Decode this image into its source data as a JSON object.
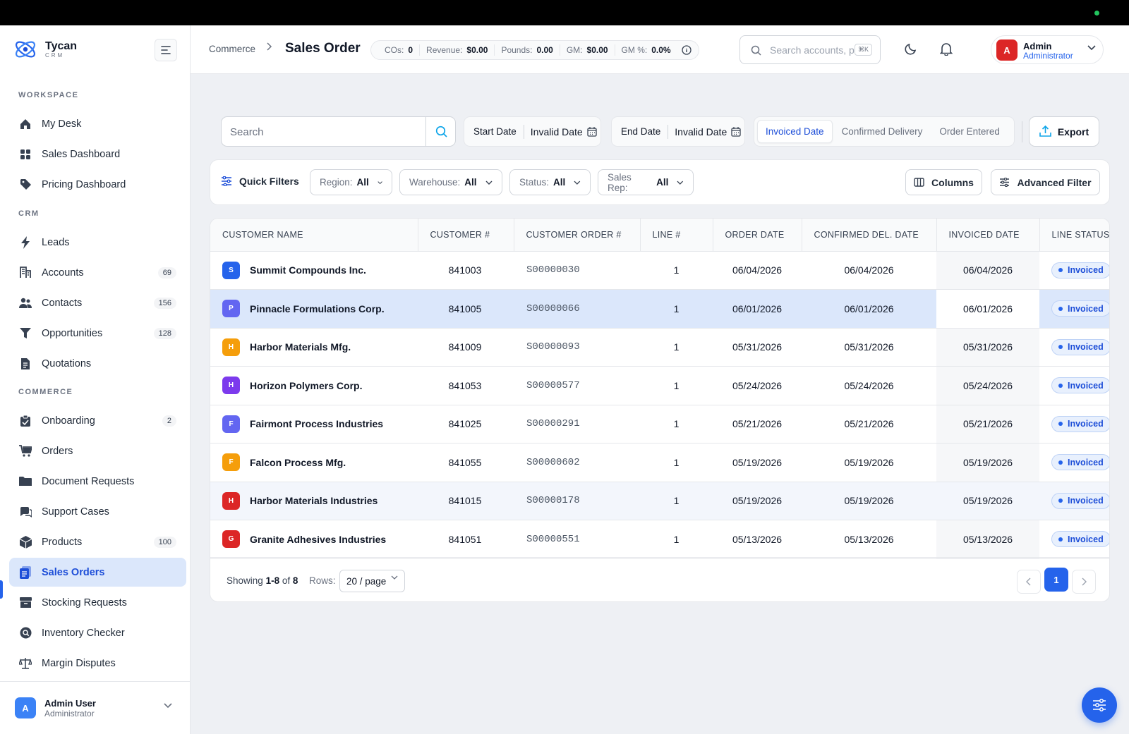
{
  "app": {
    "name": "Tycan",
    "sub": "CRM"
  },
  "sidebar": {
    "sections": [
      "WORKSPACE",
      "CRM",
      "COMMERCE"
    ],
    "workspace": [
      {
        "label": "My Desk",
        "icon": "home-icon"
      },
      {
        "label": "Sales Dashboard",
        "icon": "grid-icon"
      },
      {
        "label": "Pricing Dashboard",
        "icon": "tag-icon"
      }
    ],
    "crm": [
      {
        "label": "Leads",
        "icon": "bolt-icon",
        "count": ""
      },
      {
        "label": "Accounts",
        "icon": "building-icon",
        "count": "69"
      },
      {
        "label": "Contacts",
        "icon": "users-icon",
        "count": "156"
      },
      {
        "label": "Opportunities",
        "icon": "funnel-icon",
        "count": "128"
      },
      {
        "label": "Quotations",
        "icon": "document-icon",
        "count": ""
      }
    ],
    "commerce": [
      {
        "label": "Onboarding",
        "icon": "clipboard-icon",
        "count": "2"
      },
      {
        "label": "Orders",
        "icon": "cart-icon",
        "count": ""
      },
      {
        "label": "Document Requests",
        "icon": "folder-icon",
        "count": ""
      },
      {
        "label": "Support Cases",
        "icon": "chat-icon",
        "count": ""
      },
      {
        "label": "Products",
        "icon": "box-icon",
        "count": "100"
      },
      {
        "label": "Sales Orders",
        "icon": "receipt-icon",
        "count": ""
      },
      {
        "label": "Stocking Requests",
        "icon": "archive-icon",
        "count": ""
      },
      {
        "label": "Inventory Checker",
        "icon": "search-circle-icon",
        "count": ""
      },
      {
        "label": "Margin Disputes",
        "icon": "scale-icon",
        "count": ""
      }
    ],
    "user": {
      "initial": "A",
      "name": "Admin User",
      "role": "Administrator"
    }
  },
  "header": {
    "crumb_parent": "Commerce",
    "crumb_current": "Sales Order",
    "stats": [
      {
        "label": "COs:",
        "value": "0"
      },
      {
        "label": "Revenue:",
        "value": "$0.00"
      },
      {
        "label": "Pounds:",
        "value": "0.00"
      },
      {
        "label": "GM:",
        "value": "$0.00"
      },
      {
        "label": "GM %:",
        "value": "0.0%"
      }
    ],
    "search_placeholder": "Search accounts, p",
    "search_shortcut": "⌘K",
    "profile": {
      "initial": "A",
      "name": "Admin",
      "role": "Administrator"
    }
  },
  "toolbar": {
    "search_placeholder": "Search",
    "start_date_label": "Start Date",
    "start_date_value": "Invalid Date",
    "end_date_label": "End Date",
    "end_date_value": "Invalid Date",
    "date_modes": [
      "Invoiced Date",
      "Confirmed Delivery",
      "Order Entered"
    ],
    "active_mode": "Invoiced Date",
    "export_label": "Export"
  },
  "filters": {
    "quick_label": "Quick Filters",
    "dropdowns": [
      {
        "label": "Region:",
        "value": "All"
      },
      {
        "label": "Warehouse:",
        "value": "All"
      },
      {
        "label": "Status:",
        "value": "All"
      },
      {
        "label": "Sales Rep:",
        "value": "All"
      }
    ],
    "columns_label": "Columns",
    "advanced_label": "Advanced Filter"
  },
  "table": {
    "headers": [
      "CUSTOMER NAME",
      "CUSTOMER #",
      "CUSTOMER ORDER #",
      "LINE #",
      "ORDER DATE",
      "CONFIRMED DEL. DATE",
      "INVOICED DATE",
      "LINE STATUS"
    ],
    "rows": [
      {
        "initial": "S",
        "color": "#2563eb",
        "name": "Summit Compounds Inc.",
        "cust": "841003",
        "order": "S00000030",
        "line": "1",
        "order_date": "06/04/2026",
        "conf_date": "06/04/2026",
        "inv_date": "06/04/2026",
        "status": "Invoiced"
      },
      {
        "initial": "P",
        "color": "#6366f1",
        "name": "Pinnacle Formulations Corp.",
        "cust": "841005",
        "order": "S00000066",
        "line": "1",
        "order_date": "06/01/2026",
        "conf_date": "06/01/2026",
        "inv_date": "06/01/2026",
        "status": "Invoiced"
      },
      {
        "initial": "H",
        "color": "#f59e0b",
        "name": "Harbor Materials Mfg.",
        "cust": "841009",
        "order": "S00000093",
        "line": "1",
        "order_date": "05/31/2026",
        "conf_date": "05/31/2026",
        "inv_date": "05/31/2026",
        "status": "Invoiced"
      },
      {
        "initial": "H",
        "color": "#7c3aed",
        "name": "Horizon Polymers Corp.",
        "cust": "841053",
        "order": "S00000577",
        "line": "1",
        "order_date": "05/24/2026",
        "conf_date": "05/24/2026",
        "inv_date": "05/24/2026",
        "status": "Invoiced"
      },
      {
        "initial": "F",
        "color": "#6366f1",
        "name": "Fairmont Process Industries",
        "cust": "841025",
        "order": "S00000291",
        "line": "1",
        "order_date": "05/21/2026",
        "conf_date": "05/21/2026",
        "inv_date": "05/21/2026",
        "status": "Invoiced"
      },
      {
        "initial": "F",
        "color": "#f59e0b",
        "name": "Falcon Process Mfg.",
        "cust": "841055",
        "order": "S00000602",
        "line": "1",
        "order_date": "05/19/2026",
        "conf_date": "05/19/2026",
        "inv_date": "05/19/2026",
        "status": "Invoiced"
      },
      {
        "initial": "H",
        "color": "#dc2626",
        "name": "Harbor Materials Industries",
        "cust": "841015",
        "order": "S00000178",
        "line": "1",
        "order_date": "05/19/2026",
        "conf_date": "05/19/2026",
        "inv_date": "05/19/2026",
        "status": "Invoiced"
      },
      {
        "initial": "G",
        "color": "#dc2626",
        "name": "Granite Adhesives Industries",
        "cust": "841051",
        "order": "S00000551",
        "line": "1",
        "order_date": "05/13/2026",
        "conf_date": "05/13/2026",
        "inv_date": "05/13/2026",
        "status": "Invoiced"
      }
    ]
  },
  "pagination": {
    "showing_prefix": "Showing",
    "range": "1-8",
    "of": "of",
    "total": "8",
    "rows_label": "Rows:",
    "rows_value": "20 / page",
    "current_page": "1"
  },
  "colors": {
    "accent": "#2563eb",
    "selected_row": "#dbe7fb"
  }
}
